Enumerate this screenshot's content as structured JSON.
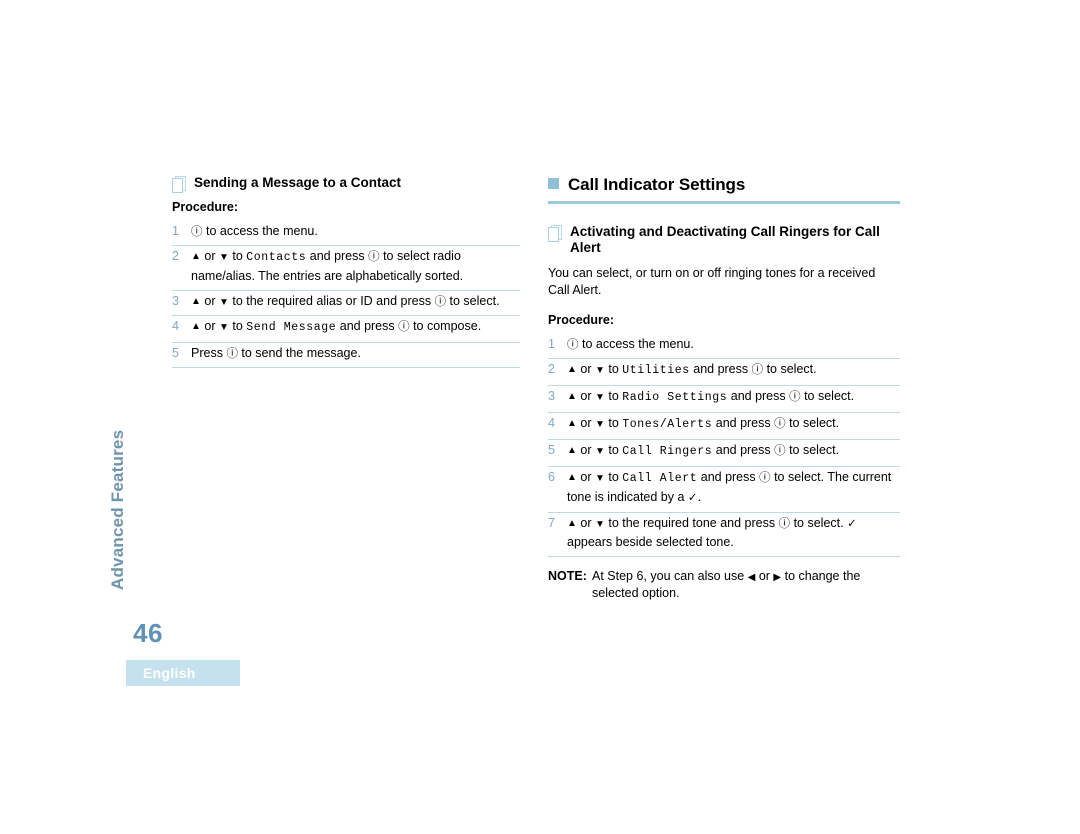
{
  "page": {
    "number": "46",
    "side_tab_label": "Advanced Features",
    "language_badge": "English",
    "accent_color": "#8fc0d8",
    "rule_color": "#bcd9e8",
    "step_number_color": "#7fa9c6",
    "page_number_color": "#5e91b4",
    "side_tab_color": "#6f94ad"
  },
  "left_column": {
    "sub_header": "Sending a Message to a Contact",
    "procedure_label": "Procedure:",
    "steps": [
      {
        "number": "1",
        "parts": [
          {
            "type": "glyph",
            "name": "menu-button-icon",
            "text": "ⓘ"
          },
          {
            "type": "text",
            "text": " to access the  menu."
          }
        ]
      },
      {
        "number": "2",
        "parts": [
          {
            "type": "glyph",
            "name": "arrow-up-icon",
            "text": "▲"
          },
          {
            "type": "text",
            "text": " or "
          },
          {
            "type": "glyph",
            "name": "arrow-down-icon",
            "text": "▼"
          },
          {
            "type": "text",
            "text": " to "
          },
          {
            "type": "mono",
            "text": "Contacts"
          },
          {
            "type": "text",
            "text": " and press "
          },
          {
            "type": "glyph",
            "name": "menu-button-icon",
            "text": "ⓘ"
          },
          {
            "type": "text",
            "text": " to select radio name/alias. The entries are alphabetically sorted."
          }
        ]
      },
      {
        "number": "3",
        "parts": [
          {
            "type": "glyph",
            "name": "arrow-up-icon",
            "text": "▲"
          },
          {
            "type": "text",
            "text": " or "
          },
          {
            "type": "glyph",
            "name": "arrow-down-icon",
            "text": "▼"
          },
          {
            "type": "text",
            "text": " to the required alias or ID and press "
          },
          {
            "type": "glyph",
            "name": "menu-button-icon",
            "text": "ⓘ"
          },
          {
            "type": "text",
            "text": " to select."
          }
        ]
      },
      {
        "number": "4",
        "parts": [
          {
            "type": "glyph",
            "name": "arrow-up-icon",
            "text": "▲"
          },
          {
            "type": "text",
            "text": " or "
          },
          {
            "type": "glyph",
            "name": "arrow-down-icon",
            "text": "▼"
          },
          {
            "type": "text",
            "text": " to "
          },
          {
            "type": "mono",
            "text": "Send Message"
          },
          {
            "type": "text",
            "text": " and press "
          },
          {
            "type": "glyph",
            "name": "menu-button-icon",
            "text": "ⓘ"
          },
          {
            "type": "text",
            "text": " to compose."
          }
        ]
      },
      {
        "number": "5",
        "parts": [
          {
            "type": "text",
            "text": "Press "
          },
          {
            "type": "glyph",
            "name": "menu-button-icon",
            "text": "ⓘ"
          },
          {
            "type": "text",
            "text": " to send the message."
          }
        ]
      }
    ]
  },
  "right_column": {
    "section_header": "Call Indicator Settings",
    "sub_header": "Activating and Deactivating Call Ringers for Call Alert",
    "intro": "You can select, or turn on or off ringing tones for a received Call Alert.",
    "procedure_label": "Procedure:",
    "steps": [
      {
        "number": "1",
        "parts": [
          {
            "type": "glyph",
            "name": "menu-button-icon",
            "text": "ⓘ"
          },
          {
            "type": "text",
            "text": " to access the menu."
          }
        ]
      },
      {
        "number": "2",
        "parts": [
          {
            "type": "glyph",
            "name": "arrow-up-icon",
            "text": "▲"
          },
          {
            "type": "text",
            "text": " or "
          },
          {
            "type": "glyph",
            "name": "arrow-down-icon",
            "text": "▼"
          },
          {
            "type": "text",
            "text": " to "
          },
          {
            "type": "mono",
            "text": "Utilities"
          },
          {
            "type": "text",
            "text": " and press "
          },
          {
            "type": "glyph",
            "name": "menu-button-icon",
            "text": "ⓘ"
          },
          {
            "type": "text",
            "text": " to select."
          }
        ]
      },
      {
        "number": "3",
        "parts": [
          {
            "type": "glyph",
            "name": "arrow-up-icon",
            "text": "▲"
          },
          {
            "type": "text",
            "text": " or "
          },
          {
            "type": "glyph",
            "name": "arrow-down-icon",
            "text": "▼"
          },
          {
            "type": "text",
            "text": " to "
          },
          {
            "type": "mono",
            "text": "Radio Settings"
          },
          {
            "type": "text",
            "text": " and press "
          },
          {
            "type": "glyph",
            "name": "menu-button-icon",
            "text": "ⓘ"
          },
          {
            "type": "text",
            "text": " to select."
          }
        ]
      },
      {
        "number": "4",
        "parts": [
          {
            "type": "glyph",
            "name": "arrow-up-icon",
            "text": "▲"
          },
          {
            "type": "text",
            "text": " or "
          },
          {
            "type": "glyph",
            "name": "arrow-down-icon",
            "text": "▼"
          },
          {
            "type": "text",
            "text": " to "
          },
          {
            "type": "mono",
            "text": "Tones/Alerts"
          },
          {
            "type": "text",
            "text": " and press "
          },
          {
            "type": "glyph",
            "name": "menu-button-icon",
            "text": "ⓘ"
          },
          {
            "type": "text",
            "text": " to select."
          }
        ]
      },
      {
        "number": "5",
        "parts": [
          {
            "type": "glyph",
            "name": "arrow-up-icon",
            "text": "▲"
          },
          {
            "type": "text",
            "text": " or "
          },
          {
            "type": "glyph",
            "name": "arrow-down-icon",
            "text": "▼"
          },
          {
            "type": "text",
            "text": " to "
          },
          {
            "type": "mono",
            "text": "Call Ringers"
          },
          {
            "type": "text",
            "text": " and press "
          },
          {
            "type": "glyph",
            "name": "menu-button-icon",
            "text": "ⓘ"
          },
          {
            "type": "text",
            "text": " to select."
          }
        ]
      },
      {
        "number": "6",
        "parts": [
          {
            "type": "glyph",
            "name": "arrow-up-icon",
            "text": "▲"
          },
          {
            "type": "text",
            "text": " or "
          },
          {
            "type": "glyph",
            "name": "arrow-down-icon",
            "text": "▼"
          },
          {
            "type": "text",
            "text": " to "
          },
          {
            "type": "mono",
            "text": "Call Alert"
          },
          {
            "type": "text",
            "text": " and press "
          },
          {
            "type": "glyph",
            "name": "menu-button-icon",
            "text": "ⓘ"
          },
          {
            "type": "text",
            "text": " to select. The current tone is indicated by a "
          },
          {
            "type": "glyph",
            "name": "check-mark-icon",
            "text": "✓"
          },
          {
            "type": "text",
            "text": "."
          }
        ]
      },
      {
        "number": "7",
        "parts": [
          {
            "type": "glyph",
            "name": "arrow-up-icon",
            "text": "▲"
          },
          {
            "type": "text",
            "text": " or "
          },
          {
            "type": "glyph",
            "name": "arrow-down-icon",
            "text": "▼"
          },
          {
            "type": "text",
            "text": " to the required tone and press "
          },
          {
            "type": "glyph",
            "name": "menu-button-icon",
            "text": "ⓘ"
          },
          {
            "type": "text",
            "text": " to select. "
          },
          {
            "type": "glyph",
            "name": "check-mark-icon",
            "text": "✓"
          },
          {
            "type": "text",
            "text": " appears beside selected tone."
          }
        ]
      }
    ],
    "note": {
      "label": "NOTE:",
      "parts": [
        {
          "type": "text",
          "text": "At Step 6, you can also use "
        },
        {
          "type": "glyph",
          "name": "arrow-left-icon",
          "text": "◀"
        },
        {
          "type": "text",
          "text": " or "
        },
        {
          "type": "glyph",
          "name": "arrow-right-icon",
          "text": "▶"
        },
        {
          "type": "text",
          "text": " to change the selected option."
        }
      ]
    }
  }
}
